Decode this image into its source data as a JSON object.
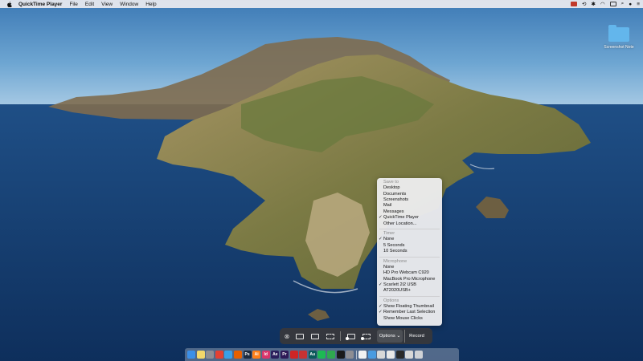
{
  "menubar": {
    "app_name": "QuickTime Player",
    "menus": [
      "File",
      "Edit",
      "View",
      "Window",
      "Help"
    ]
  },
  "desktop": {
    "folder_label": "Screenshot Note"
  },
  "options_menu": {
    "save_to": {
      "heading": "Save to",
      "items": [
        {
          "label": "Desktop",
          "checked": false
        },
        {
          "label": "Documents",
          "checked": false
        },
        {
          "label": "Screenshots",
          "checked": false
        },
        {
          "label": "Mail",
          "checked": false
        },
        {
          "label": "Messages",
          "checked": false
        },
        {
          "label": "QuickTime Player",
          "checked": true
        },
        {
          "label": "Other Location...",
          "checked": false
        }
      ]
    },
    "timer": {
      "heading": "Timer",
      "items": [
        {
          "label": "None",
          "checked": true
        },
        {
          "label": "5 Seconds",
          "checked": false
        },
        {
          "label": "10 Seconds",
          "checked": false
        }
      ]
    },
    "microphone": {
      "heading": "Microphone",
      "items": [
        {
          "label": "None",
          "checked": false
        },
        {
          "label": "HD Pro Webcam C920",
          "checked": false
        },
        {
          "label": "MacBook Pro Microphone",
          "checked": false
        },
        {
          "label": "Scarlett 2i2 USB",
          "checked": true
        },
        {
          "label": "AT2020USB+",
          "checked": false
        }
      ]
    },
    "options": {
      "heading": "Options",
      "items": [
        {
          "label": "Show Floating Thumbnail",
          "checked": true
        },
        {
          "label": "Remember Last Selection",
          "checked": true
        },
        {
          "label": "Show Mouse Clicks",
          "checked": false
        }
      ]
    }
  },
  "toolbar": {
    "options_label": "Options ⌄",
    "record_label": "Record",
    "close_glyph": "⊗"
  },
  "dock": {
    "apps": [
      {
        "icon": "finder-icon",
        "color": "#3b8fe8"
      },
      {
        "icon": "notes-icon",
        "color": "#f3d86b"
      },
      {
        "icon": "launchpad-icon",
        "color": "#8e8e93"
      },
      {
        "icon": "chrome-icon",
        "color": "#e34133"
      },
      {
        "icon": "safari-icon",
        "color": "#3aa0e8"
      },
      {
        "icon": "firefox-icon",
        "color": "#e66000"
      },
      {
        "icon": "photoshop-icon",
        "color": "#1c2b3f",
        "text": "Ps"
      },
      {
        "icon": "illustrator-icon",
        "color": "#ff7f18",
        "text": "Ai"
      },
      {
        "icon": "indesign-icon",
        "color": "#d9346a",
        "text": "Id"
      },
      {
        "icon": "aftereffects-icon",
        "color": "#2a1f5c",
        "text": "Ae"
      },
      {
        "icon": "premiere-icon",
        "color": "#2f1a57",
        "text": "Pr"
      },
      {
        "icon": "acrobat-icon",
        "color": "#cf2525"
      },
      {
        "icon": "fontbook-icon",
        "color": "#c83232"
      },
      {
        "icon": "audition-icon",
        "color": "#0a5a5a",
        "text": "Au"
      },
      {
        "icon": "spotify-icon",
        "color": "#1db954"
      },
      {
        "icon": "camtasia-icon",
        "color": "#2fa84f"
      },
      {
        "icon": "terminal-icon",
        "color": "#1a1a1a"
      },
      {
        "icon": "preferences-icon",
        "color": "#8e8e93"
      },
      {
        "icon": "preview-icon",
        "color": "#f2f2f2"
      },
      {
        "icon": "mail-icon",
        "color": "#4a9be0"
      },
      {
        "icon": "window-icon",
        "color": "#d8d8d8"
      },
      {
        "icon": "window-icon",
        "color": "#e8e8e8"
      },
      {
        "icon": "window-icon",
        "color": "#2a2a2a"
      },
      {
        "icon": "window-icon",
        "color": "#d8d8d8"
      },
      {
        "icon": "trash-icon",
        "color": "#cfd2d6"
      }
    ]
  }
}
